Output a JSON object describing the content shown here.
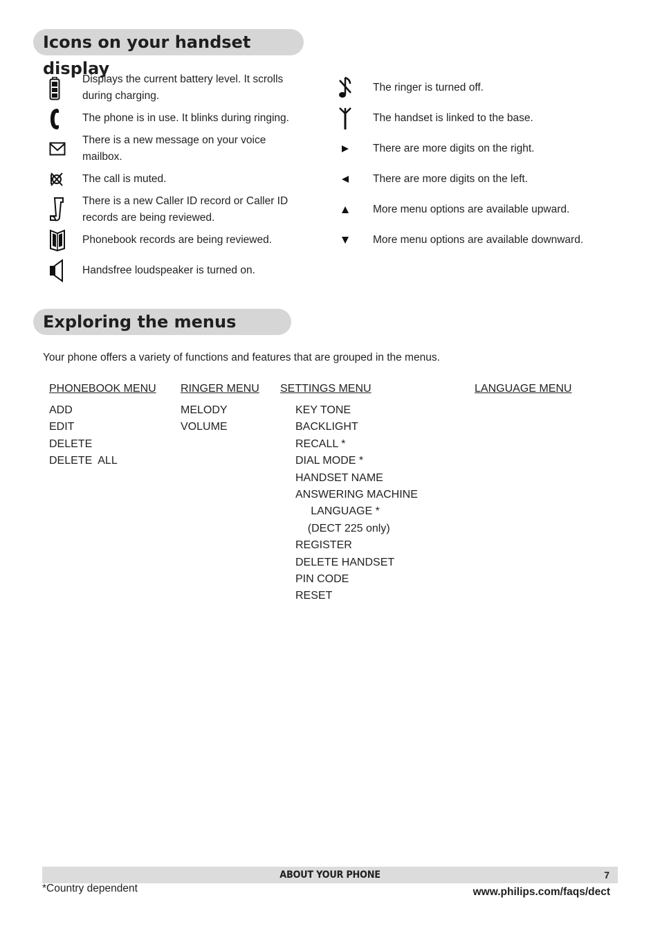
{
  "sections": {
    "icons_title": "Icons on your handset display",
    "menus_title": "Exploring the menus"
  },
  "icons_left": [
    {
      "icon": "battery-icon",
      "text": "Displays the current battery level.  It scrolls during charging."
    },
    {
      "icon": "phone-handset-icon",
      "text": "The phone is in use.  It blinks during ringing."
    },
    {
      "icon": "envelope-icon",
      "text": "There is a new message on your voice mailbox."
    },
    {
      "icon": "mute-icon",
      "text": "The call is muted."
    },
    {
      "icon": "scroll-icon",
      "text": "There is a new Caller ID record or Caller ID records are being reviewed."
    },
    {
      "icon": "phonebook-icon",
      "text": "Phonebook records are being reviewed."
    },
    {
      "icon": "speaker-icon",
      "text": "Handsfree loudspeaker is turned on."
    }
  ],
  "icons_right": [
    {
      "icon": "ringer-off-icon",
      "text": "The ringer is turned off."
    },
    {
      "icon": "antenna-icon",
      "text": "The handset is linked to the base."
    },
    {
      "icon": "arrow-right-icon",
      "text": "There are more digits on the right."
    },
    {
      "icon": "arrow-left-icon",
      "text": "There are more digits on the left."
    },
    {
      "icon": "arrow-up-icon",
      "text": "More menu options are available upward."
    },
    {
      "icon": "arrow-down-icon",
      "text": "More menu options are available downward."
    }
  ],
  "intro": "Your phone offers a variety of functions and features that are grouped in the menus.",
  "menus": [
    {
      "heading": "PHONEBOOK MENU",
      "items": [
        "ADD",
        "EDIT",
        "DELETE",
        "DELETE  ALL"
      ]
    },
    {
      "heading": "RINGER MENU",
      "items": [
        "MELODY",
        "VOLUME"
      ]
    },
    {
      "heading": "SETTINGS MENU",
      "items": [
        "KEY TONE",
        "BACKLIGHT",
        "RECALL *",
        "DIAL MODE *",
        "HANDSET NAME",
        "ANSWERING MACHINE",
        "     LANGUAGE *",
        "    (DECT 225 only)",
        "REGISTER",
        "DELETE HANDSET",
        "PIN CODE",
        "RESET"
      ]
    },
    {
      "heading": "LANGUAGE MENU",
      "items": []
    }
  ],
  "footer": {
    "section": "ABOUT YOUR PHONE",
    "page_number": "7",
    "footnote": "*Country dependent",
    "url": "www.philips.com/faqs/dect"
  }
}
